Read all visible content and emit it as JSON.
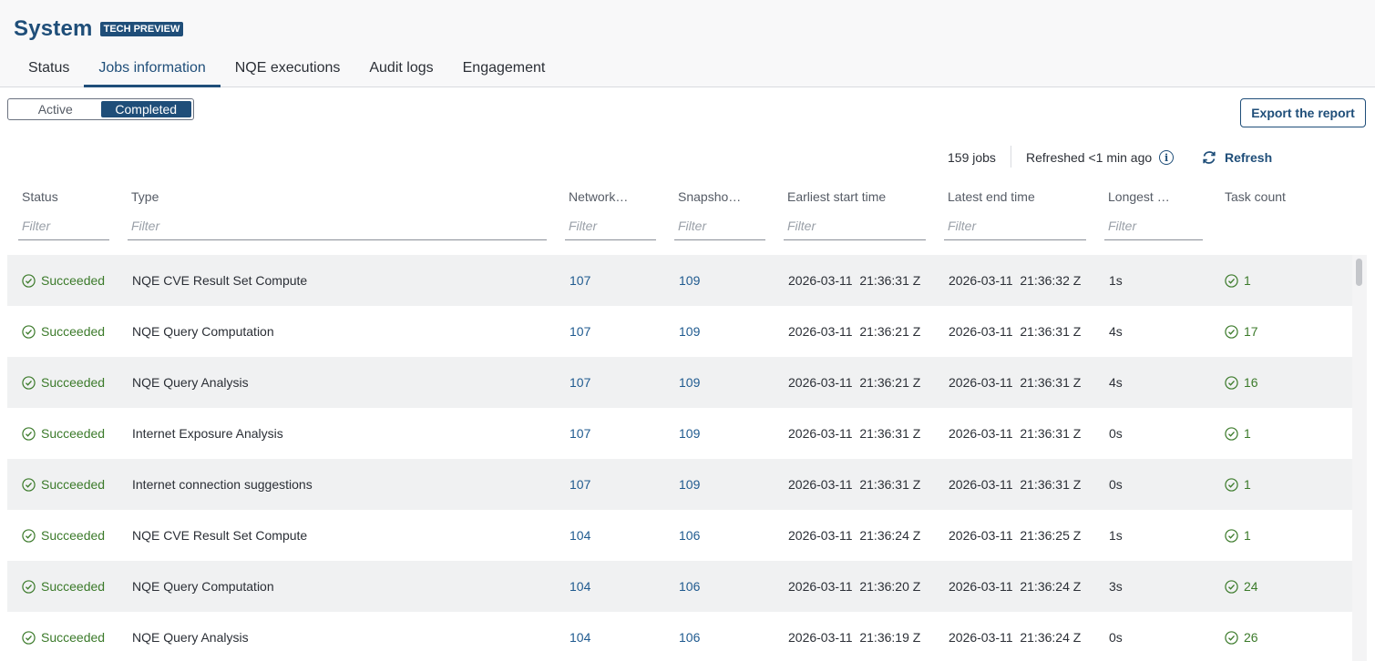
{
  "header": {
    "title": "System",
    "badge": "TECH PREVIEW"
  },
  "tabs": [
    {
      "label": "Status",
      "active": false
    },
    {
      "label": "Jobs information",
      "active": true
    },
    {
      "label": "NQE executions",
      "active": false
    },
    {
      "label": "Audit logs",
      "active": false
    },
    {
      "label": "Engagement",
      "active": false
    }
  ],
  "toggle": {
    "active_label": "Active",
    "completed_label": "Completed",
    "selected": "Completed"
  },
  "toolbar": {
    "export_label": "Export the report",
    "jobs_count": "159 jobs",
    "refreshed": "Refreshed <1 min ago",
    "refresh_label": "Refresh"
  },
  "columns": {
    "status": "Status",
    "type": "Type",
    "network": "Network…",
    "snapshot": "Snapsho…",
    "earliest": "Earliest start time",
    "latest": "Latest end time",
    "longest": "Longest …",
    "task_count": "Task count",
    "filter_placeholder": "Filter"
  },
  "rows": [
    {
      "status": "Succeeded",
      "type": "NQE CVE Result Set Compute",
      "network": "107",
      "snapshot": "109",
      "start": "2026-03-11  21:36:31 Z",
      "end": "2026-03-11  21:36:32 Z",
      "longest": "1s",
      "tasks": "1"
    },
    {
      "status": "Succeeded",
      "type": "NQE Query Computation",
      "network": "107",
      "snapshot": "109",
      "start": "2026-03-11  21:36:21 Z",
      "end": "2026-03-11  21:36:31 Z",
      "longest": "4s",
      "tasks": "17"
    },
    {
      "status": "Succeeded",
      "type": "NQE Query Analysis",
      "network": "107",
      "snapshot": "109",
      "start": "2026-03-11  21:36:21 Z",
      "end": "2026-03-11  21:36:31 Z",
      "longest": "4s",
      "tasks": "16"
    },
    {
      "status": "Succeeded",
      "type": "Internet Exposure Analysis",
      "network": "107",
      "snapshot": "109",
      "start": "2026-03-11  21:36:31 Z",
      "end": "2026-03-11  21:36:31 Z",
      "longest": "0s",
      "tasks": "1"
    },
    {
      "status": "Succeeded",
      "type": "Internet connection suggestions",
      "network": "107",
      "snapshot": "109",
      "start": "2026-03-11  21:36:31 Z",
      "end": "2026-03-11  21:36:31 Z",
      "longest": "0s",
      "tasks": "1"
    },
    {
      "status": "Succeeded",
      "type": "NQE CVE Result Set Compute",
      "network": "104",
      "snapshot": "106",
      "start": "2026-03-11  21:36:24 Z",
      "end": "2026-03-11  21:36:25 Z",
      "longest": "1s",
      "tasks": "1"
    },
    {
      "status": "Succeeded",
      "type": "NQE Query Computation",
      "network": "104",
      "snapshot": "106",
      "start": "2026-03-11  21:36:20 Z",
      "end": "2026-03-11  21:36:24 Z",
      "longest": "3s",
      "tasks": "24"
    },
    {
      "status": "Succeeded",
      "type": "NQE Query Analysis",
      "network": "104",
      "snapshot": "106",
      "start": "2026-03-11  21:36:19 Z",
      "end": "2026-03-11  21:36:24 Z",
      "longest": "0s",
      "tasks": "26"
    }
  ],
  "icons": {
    "status_icon": "check-circle-icon",
    "info_icon": "info-icon",
    "refresh_icon": "refresh-icon"
  },
  "colors": {
    "brand": "#1f4e79",
    "success": "#3b7a2a",
    "link": "#1f5a8f"
  }
}
